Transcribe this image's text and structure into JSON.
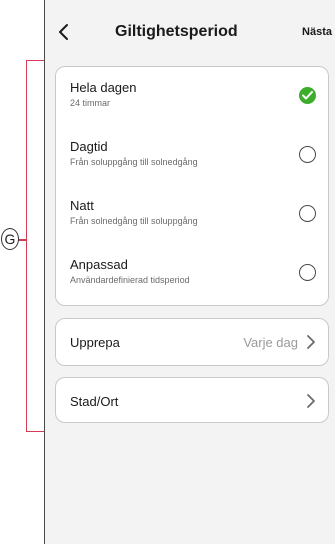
{
  "header": {
    "title": "Giltighetsperiod",
    "next_label": "Nästa",
    "back_icon": "chevron-left-icon"
  },
  "options": [
    {
      "label": "Hela dagen",
      "sublabel": "24 timmar",
      "selected": true
    },
    {
      "label": "Dagtid",
      "sublabel": "Från soluppgång till solnedgång",
      "selected": false
    },
    {
      "label": "Natt",
      "sublabel": "Från solnedgång till soluppgång",
      "selected": false
    },
    {
      "label": "Anpassad",
      "sublabel": "Användardefinierad tidsperiod",
      "selected": false
    }
  ],
  "repeat": {
    "label": "Upprepa",
    "value": "Varje dag"
  },
  "city": {
    "label": "Stad/Ort",
    "value": ""
  },
  "annotation": {
    "callout_label": "G"
  },
  "colors": {
    "accent_green": "#3dae2b",
    "annotation_red": "#d23a55",
    "background": "#f3f3f3"
  }
}
